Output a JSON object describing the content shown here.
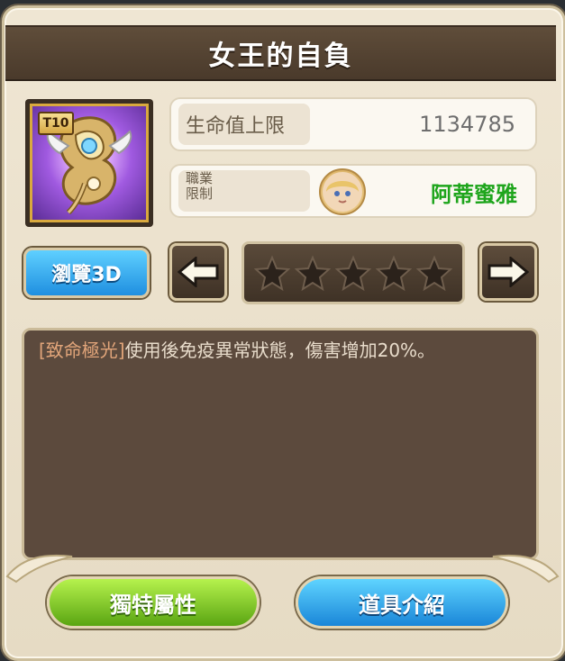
{
  "title": "女王的自負",
  "item": {
    "tier": "T10",
    "icon": "weapon-artifact-icon"
  },
  "stats": {
    "hp_label": "生命值上限",
    "hp_value": "1134785",
    "job_label": "職業限制",
    "job_label_line1": "職業",
    "job_label_line2": "限制",
    "character_name": "阿蒂蜜雅",
    "character_name_color": "#1ea51c"
  },
  "controls": {
    "view3d_label": "瀏覽3D",
    "stars_filled": 0,
    "stars_total": 5
  },
  "description": {
    "tag": "[致命極光]",
    "body": "使用後免疫異常狀態，傷害增加20%。"
  },
  "bottom": {
    "unique_attr_label": "獨特屬性",
    "item_intro_label": "道具介紹"
  },
  "colors": {
    "panel_bg": "#5c4a3d",
    "title_bg": "#5f4d3a",
    "green_button": "#5aa512",
    "blue_button": "#1a86d8"
  }
}
